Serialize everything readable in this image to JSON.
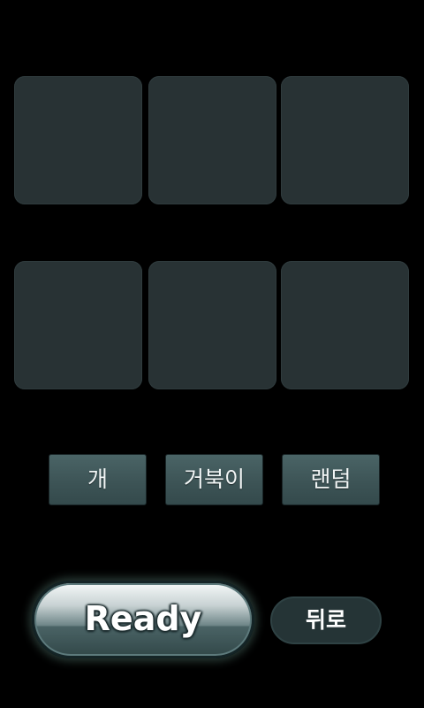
{
  "grid": {
    "cards": [
      {
        "label": ""
      },
      {
        "label": ""
      },
      {
        "label": ""
      },
      {
        "label": ""
      },
      {
        "label": ""
      },
      {
        "label": ""
      }
    ]
  },
  "options": [
    {
      "label": "개"
    },
    {
      "label": "거북이"
    },
    {
      "label": "랜덤"
    }
  ],
  "controls": {
    "ready_label": "Ready",
    "back_label": "뒤로"
  },
  "colors": {
    "background": "#000000",
    "card": "#283234",
    "button": "#3f5759",
    "accent_glow": "#5a8278"
  }
}
